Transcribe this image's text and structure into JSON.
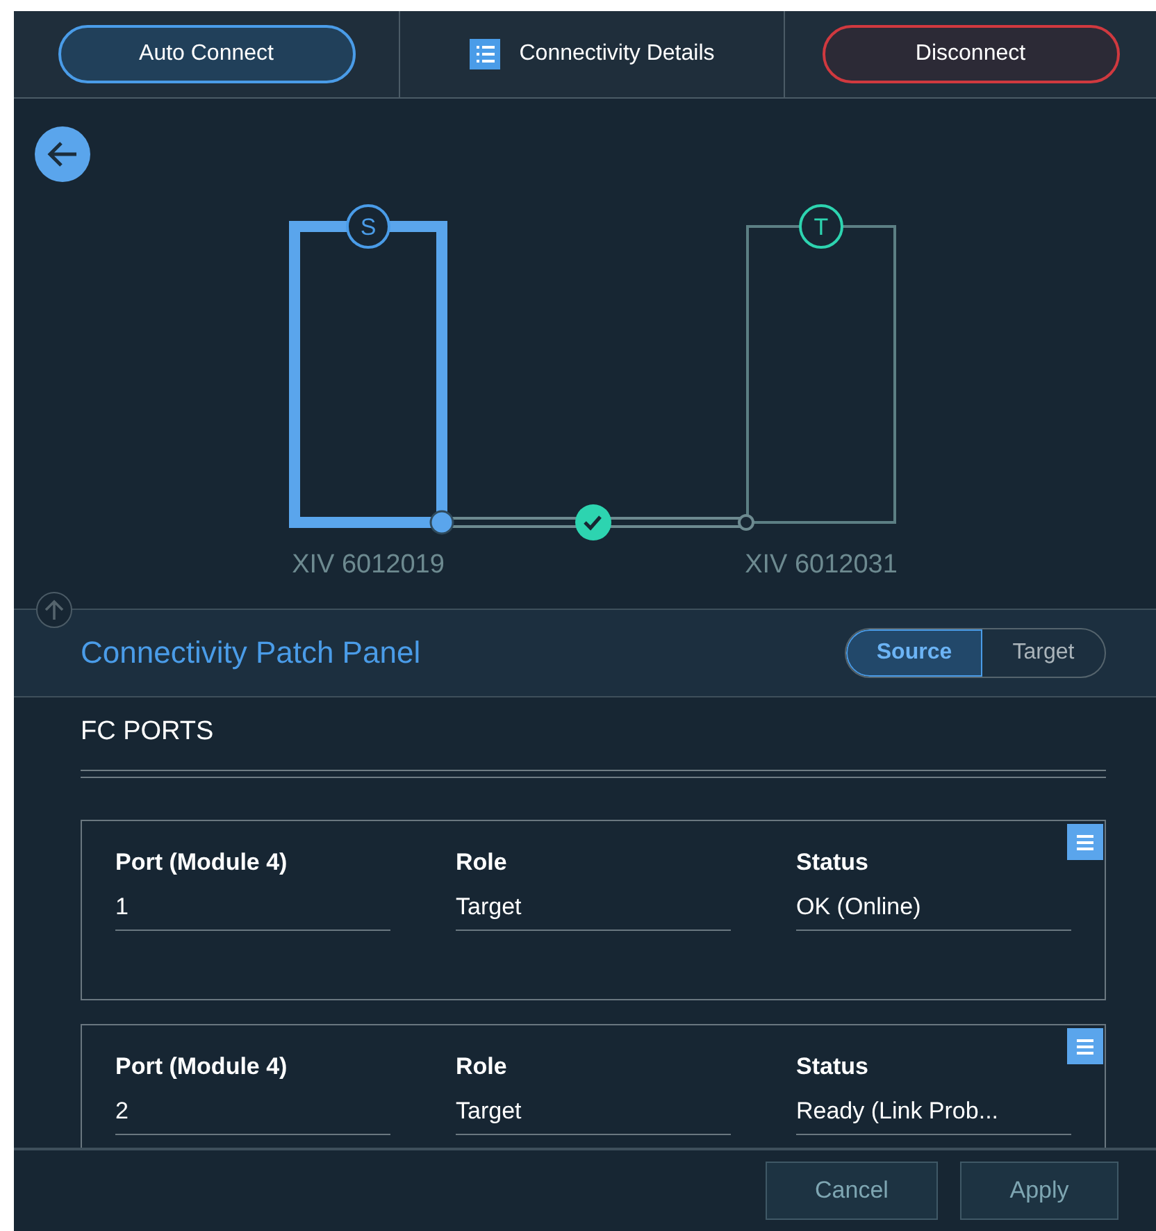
{
  "toolbar": {
    "buttons": [
      {
        "label": "Auto Connect",
        "kind": "primary"
      },
      {
        "label": "Connectivity Details",
        "kind": "details"
      },
      {
        "label": "Disconnect",
        "kind": "danger"
      }
    ]
  },
  "diagram": {
    "source": {
      "badge": "S",
      "name": "XIV 6012019",
      "selected": true
    },
    "target": {
      "badge": "T",
      "name": "XIV 6012031",
      "selected": false
    },
    "link": {
      "connected": true
    }
  },
  "patch_panel": {
    "title": "Connectivity Patch Panel",
    "toggle": [
      {
        "label": "Source",
        "selected": true
      },
      {
        "label": "Target",
        "selected": false
      }
    ]
  },
  "section": {
    "title": "FC PORTS"
  },
  "ports": [
    {
      "fields": [
        {
          "label": "Port (Module 4)",
          "value": "1"
        },
        {
          "label": "Role",
          "value": "Target"
        },
        {
          "label": "Status",
          "value": "OK (Online)"
        }
      ]
    },
    {
      "fields": [
        {
          "label": "Port (Module 4)",
          "value": "2"
        },
        {
          "label": "Role",
          "value": "Target"
        },
        {
          "label": "Status",
          "value": "Ready (Link Prob..."
        }
      ]
    }
  ],
  "footer": {
    "buttons": [
      {
        "label": "Cancel",
        "disabled": true
      },
      {
        "label": "Apply",
        "disabled": true
      }
    ]
  }
}
